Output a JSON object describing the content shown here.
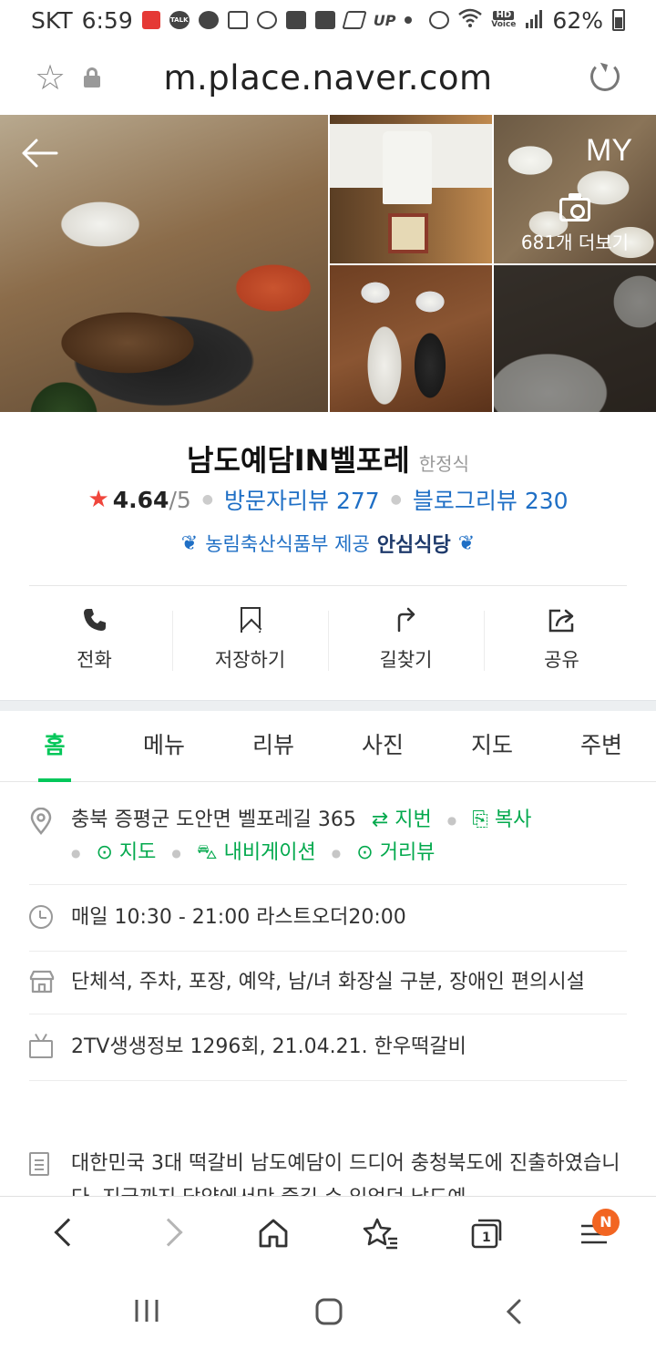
{
  "status_bar": {
    "carrier": "SKT",
    "time": "6:59",
    "battery": "62%",
    "hd_label": "HD",
    "voice_label": "Voice",
    "talk_label": "TALK",
    "up_label": "UP"
  },
  "url_bar": {
    "url": "m.place.naver.com"
  },
  "photos": {
    "my_label": "MY",
    "more_label": "681개 더보기"
  },
  "place": {
    "name": "남도예담IN벨포레",
    "category": "한정식",
    "rating": "4.64",
    "rating_max": "/5",
    "visitor_review": "방문자리뷰 277",
    "blog_review": "블로그리뷰 230",
    "badge_text": "농림축산식품부 제공",
    "badge_strong": "안심식당"
  },
  "actions": [
    {
      "label": "전화",
      "icon": "phone-icon"
    },
    {
      "label": "저장하기",
      "icon": "bookmark-icon"
    },
    {
      "label": "길찾기",
      "icon": "route-icon"
    },
    {
      "label": "공유",
      "icon": "share-icon"
    }
  ],
  "tabs": [
    {
      "label": "홈",
      "active": true
    },
    {
      "label": "메뉴",
      "active": false
    },
    {
      "label": "리뷰",
      "active": false
    },
    {
      "label": "사진",
      "active": false
    },
    {
      "label": "지도",
      "active": false
    },
    {
      "label": "주변",
      "active": false
    }
  ],
  "info": {
    "address": "충북 증평군 도안면 벨포레길 365",
    "address_links": {
      "jibun": "지번",
      "copy": "복사",
      "map": "지도",
      "navigation": "내비게이션",
      "street_view": "거리뷰"
    },
    "hours": "매일 10:30 - 21:00 라스트오더20:00",
    "facilities": "단체석, 주차, 포장, 예약, 남/녀 화장실 구분, 장애인 편의시설",
    "tv": "2TV생생정보 1296회, 21.04.21. 한우떡갈비",
    "description": "대한민국 3대 떡갈비 남도예담이 드디어 충청북도에 진출하였습니다. 지금까지 담양에서만 즐길 수 있었던 남도예"
  },
  "bottom_bar": {
    "tabs_count": "1",
    "menu_badge": "N"
  },
  "colors": {
    "green": "#03c75a",
    "blue": "#1f6fc5",
    "star": "#f0463c",
    "badge_orange": "#f26522"
  }
}
